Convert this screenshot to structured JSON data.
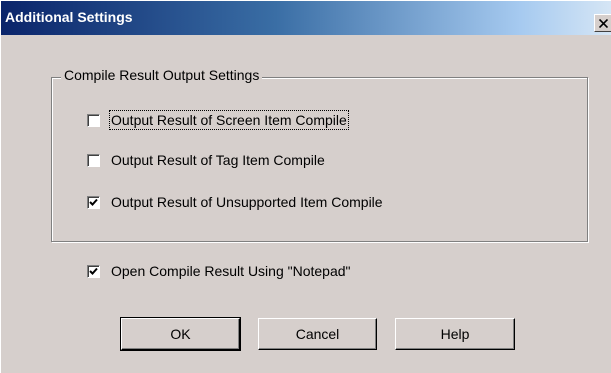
{
  "dialog": {
    "title": "Additional Settings",
    "close_glyph": "×"
  },
  "group": {
    "legend": "Compile Result Output Settings",
    "options": [
      {
        "label": "Output Result of Screen Item Compile",
        "checked": false
      },
      {
        "label": "Output Result of Tag Item Compile",
        "checked": false
      },
      {
        "label": "Output Result of Unsupported Item Compile",
        "checked": true
      }
    ]
  },
  "notepad_option": {
    "label": "Open Compile Result Using \"Notepad\"",
    "checked": true
  },
  "buttons": {
    "ok": "OK",
    "cancel": "Cancel",
    "help": "Help"
  },
  "colors": {
    "face": "#d6cfcc",
    "title_start": "#0a246a",
    "title_end": "#d6e6f5"
  },
  "icons": {
    "close": "close-icon",
    "check": "check-mark-icon"
  }
}
